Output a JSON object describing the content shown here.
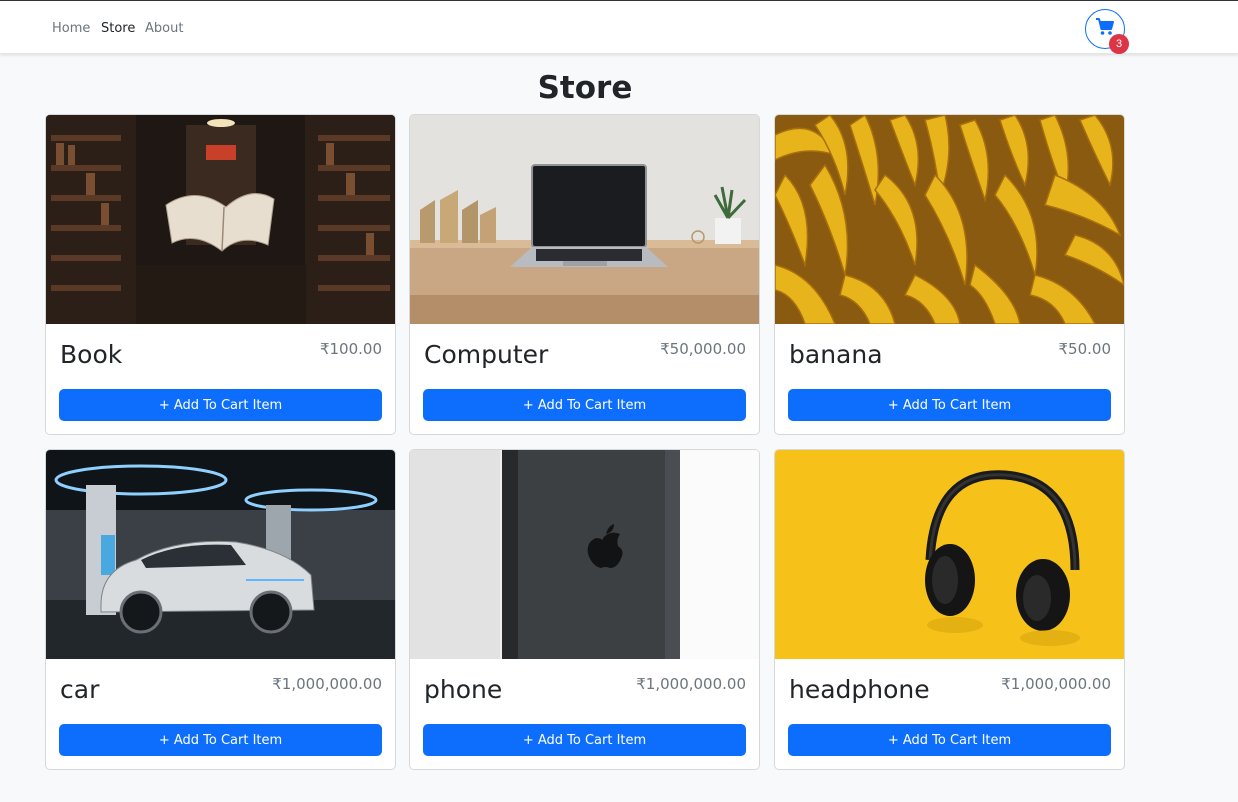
{
  "nav": {
    "links": [
      {
        "label": "Home",
        "active": false
      },
      {
        "label": "Store",
        "active": true
      },
      {
        "label": "About",
        "active": false
      }
    ],
    "cart_icon": "shopping-cart-icon",
    "cart_count": "3"
  },
  "page": {
    "title": "Store"
  },
  "colors": {
    "primary": "#0d6efd",
    "badge": "#dc3545",
    "muted": "#6c757d"
  },
  "products": [
    {
      "name": "Book",
      "price": "₹100.00",
      "button": "+ Add To Cart Item",
      "image": "book-photo"
    },
    {
      "name": "Computer",
      "price": "₹50,000.00",
      "button": "+ Add To Cart Item",
      "image": "laptop-photo"
    },
    {
      "name": "banana",
      "price": "₹50.00",
      "button": "+ Add To Cart Item",
      "image": "banana-photo"
    },
    {
      "name": "car",
      "price": "₹1,000,000.00",
      "button": "+ Add To Cart Item",
      "image": "car-photo"
    },
    {
      "name": "phone",
      "price": "₹1,000,000.00",
      "button": "+ Add To Cart Item",
      "image": "phone-photo"
    },
    {
      "name": "headphone",
      "price": "₹1,000,000.00",
      "button": "+ Add To Cart Item",
      "image": "headphone-photo"
    }
  ]
}
